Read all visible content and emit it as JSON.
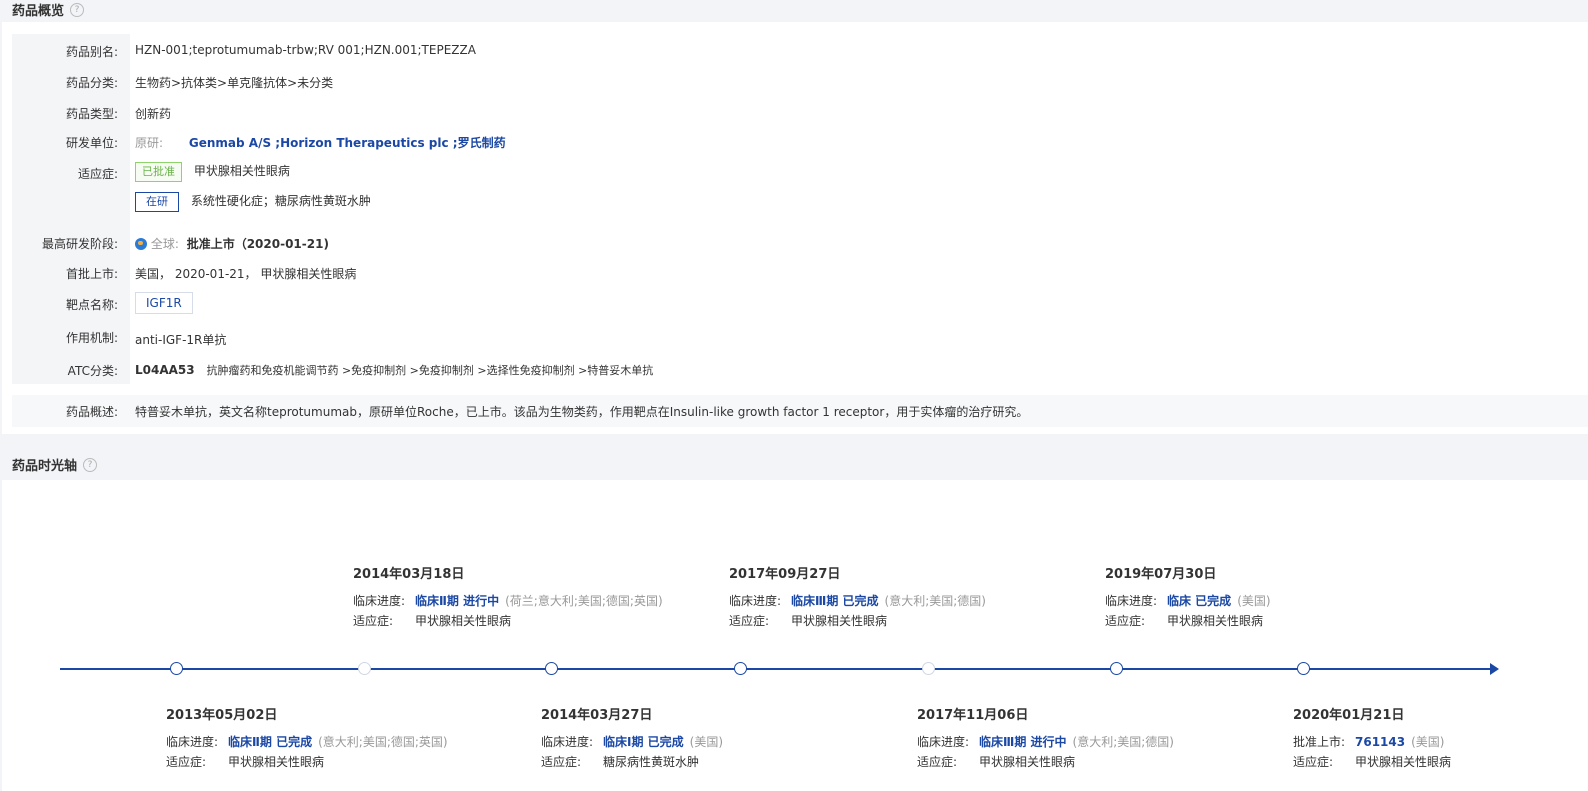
{
  "overview": {
    "title": "药品概览",
    "help": "?",
    "rows": {
      "alias": {
        "label": "药品别名:",
        "value": "HZN-001;teprotumumab-trbw;RV 001;HZN.001;TEPEZZA"
      },
      "category": {
        "label": "药品分类:",
        "value": "生物药>抗体类>单克隆抗体>未分类"
      },
      "type": {
        "label": "药品类型:",
        "value": "创新药"
      },
      "developer": {
        "label": "研发单位:",
        "prefix": "原研:",
        "value": "Genmab A/S ;Horizon Therapeutics plc ;罗氏制药"
      },
      "indication": {
        "label": "适应症:",
        "approved_tag": "已批准",
        "approved_value": "甲状腺相关性眼病",
        "research_tag": "在研",
        "research_value": "系统性硬化症；糖尿病性黄斑水肿"
      },
      "highest_stage": {
        "label": "最高研发阶段:",
        "scope": "全球:",
        "value": "批准上市（2020-01-21)"
      },
      "first_approval": {
        "label": "首批上市:",
        "value": "美国， 2020-01-21， 甲状腺相关性眼病"
      },
      "target": {
        "label": "靶点名称:",
        "value": "IGF1R"
      },
      "mechanism": {
        "label": "作用机制:",
        "value": "anti-IGF-1R单抗"
      },
      "atc": {
        "label": "ATC分类:",
        "code": "L04AA53",
        "value": "抗肿瘤药和免疫机能调节药 >免疫抑制剂 >免疫抑制剂 >选择性免疫抑制剂 >特普妥木单抗"
      },
      "summary": {
        "label": "药品概述:",
        "value": "特普妥木单抗，英文名称teprotumumab，原研单位Roche，已上市。该品为生物类药，作用靶点在Insulin-like growth factor 1 receptor，用于实体瘤的治疗研究。"
      }
    }
  },
  "timeline": {
    "title": "药品时光轴",
    "help": "?",
    "progress_label": "临床进度:",
    "approval_label": "批准上市:",
    "indication_label": "适应症:",
    "events": [
      {
        "date": "2013年05月02日",
        "stage": "临床Ⅱ期 已完成",
        "countries": "(意大利;美国;德国;英国)",
        "indication": "甲状腺相关性眼病"
      },
      {
        "date": "2014年03月18日",
        "stage": "临床Ⅱ期 进行中",
        "countries": "(荷兰;意大利;美国;德国;英国)",
        "indication": "甲状腺相关性眼病"
      },
      {
        "date": "2014年03月27日",
        "stage": "临床Ⅰ期 已完成",
        "countries": "(美国)",
        "indication": "糖尿病性黄斑水肿"
      },
      {
        "date": "2017年09月27日",
        "stage": "临床Ⅲ期 已完成",
        "countries": "(意大利;美国;德国)",
        "indication": "甲状腺相关性眼病"
      },
      {
        "date": "2017年11月06日",
        "stage": "临床Ⅲ期 进行中",
        "countries": "(意大利;美国;德国)",
        "indication": "甲状腺相关性眼病"
      },
      {
        "date": "2019年07月30日",
        "stage": "临床 已完成",
        "countries": "(美国)",
        "indication": "甲状腺相关性眼病"
      },
      {
        "date": "2020年01月21日",
        "stage": "761143",
        "countries": "(美国)",
        "indication": "甲状腺相关性眼病"
      }
    ]
  },
  "colors": {
    "accent": "#1b48a5",
    "approved": "#6ab34a",
    "background": "#f3f4f7"
  }
}
